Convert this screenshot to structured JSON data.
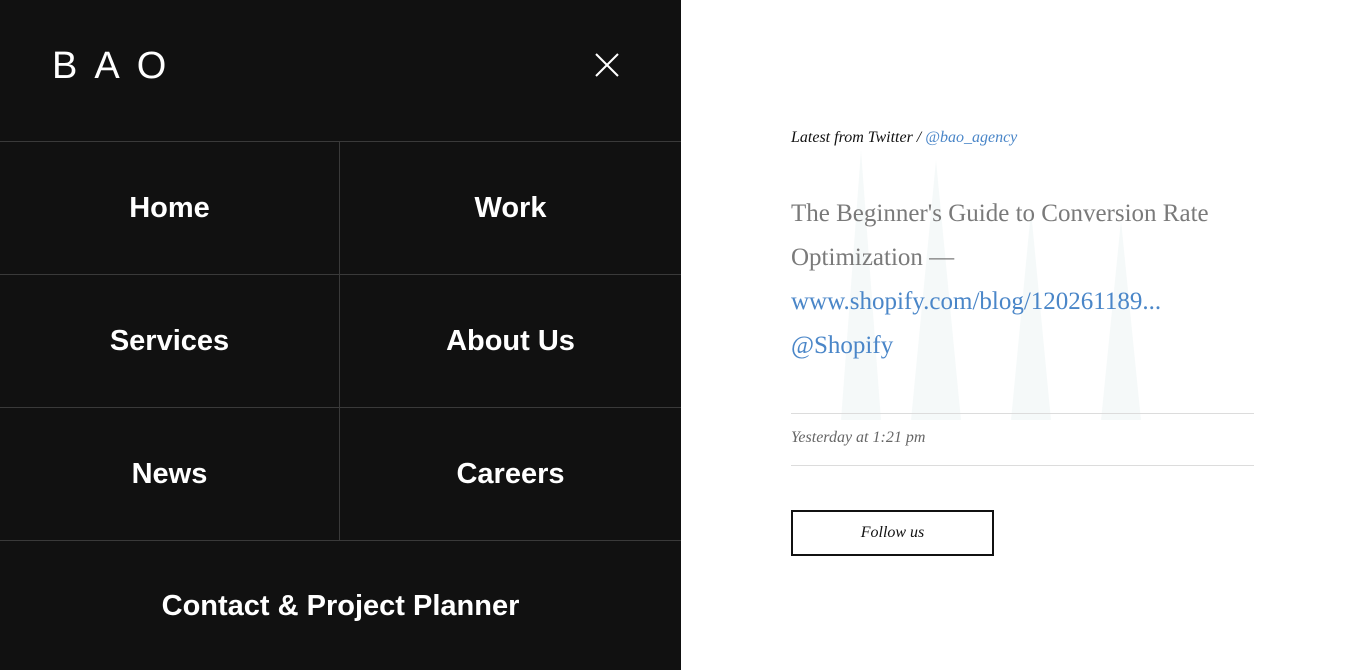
{
  "nav": {
    "logo": "BAO",
    "close_icon": "close-icon",
    "rows": [
      {
        "left": "Home",
        "right": "Work"
      },
      {
        "left": "Services",
        "right": "About Us"
      },
      {
        "left": "News",
        "right": "Careers"
      }
    ],
    "contact": "Contact & Project Planner"
  },
  "twitter": {
    "header_prefix": "Latest from Twitter / ",
    "handle": "@bao_agency",
    "tweet_text": "The Beginner's Guide to Conversion Rate Optimization —",
    "tweet_link": "www.shopify.com/blog/120261189...",
    "tweet_mention": "@Shopify",
    "time": "Yesterday at 1:21 pm",
    "follow_label": "Follow us"
  },
  "colors": {
    "nav_background": "#111111",
    "link_blue": "#4a86c8",
    "tweet_gray": "#7a7a7a"
  }
}
